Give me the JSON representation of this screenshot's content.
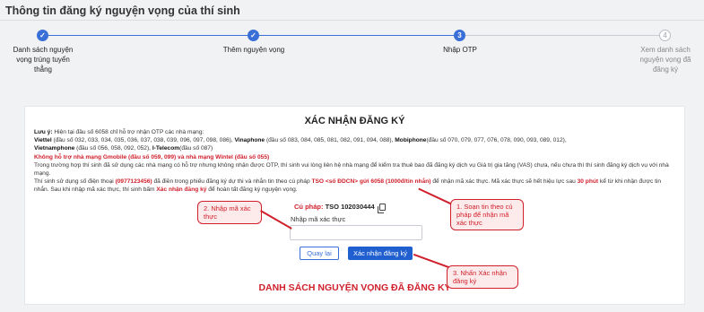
{
  "page": {
    "title": "Thông tin đăng ký nguyện vọng của thí sinh"
  },
  "steps": [
    {
      "icon": "check-icon",
      "label": "Danh sách nguyện vọng trúng tuyển thẳng",
      "state": "done",
      "mark": "✓"
    },
    {
      "icon": "check-icon",
      "label": "Thêm nguyện vọng",
      "state": "done",
      "mark": "✓"
    },
    {
      "icon": "step-3",
      "label": "Nhập OTP",
      "state": "active",
      "mark": "3"
    },
    {
      "icon": "step-4",
      "label": "Xem danh sách nguyện vọng đã đăng ký",
      "state": "pending",
      "mark": "4"
    }
  ],
  "card": {
    "title": "XÁC NHẬN ĐĂNG KÝ",
    "note_lead": "Lưu ý:",
    "note_intro": " Hiện tại đầu số 6058 chỉ hỗ trợ nhận OTP các nhà mạng:",
    "carriers_1": {
      "viettel": "Viettel",
      "viettel_nums": " (đầu số 032, 033, 034, 035, 036, 037, 038, 039, 096, 097, 098, 086), ",
      "vinaphone": "Vinaphone",
      "vinaphone_nums": " (đầu số 083, 084, 085, 081, 082, 091, 094, 088), ",
      "mobiphone": "Mobiphone",
      "mobiphone_nums": "(đầu số 070, 079, 077, 076, 078, 090, 093, 089, 012),"
    },
    "carriers_2": {
      "vietnamphone": "Vietnamphone",
      "vietnamphone_nums": " (đầu số 056, 058, 092, 052), ",
      "itelecom": "I-Telecom",
      "itelecom_nums": "(đầu số 087)"
    },
    "unsupported": "Không hỗ trợ nhà mạng Gmobile (đầu số 059, 099) và nhà mạng Wintel (đầu số 055)",
    "vas_note": "Trong trường hợp thí sinh đã sử dụng các nhà mạng có hỗ trợ nhưng không nhận được OTP, thí sinh vui lòng liên hệ nhà mạng để kiểm tra thuê bao đã đăng ký dịch vụ Giá trị gia tăng (VAS) chưa, nếu chưa thì thí sinh đăng ký dịch vụ với nhà mạng.",
    "sms": {
      "p1": "Thí sinh sử dụng số điện thoại ",
      "phone": "(0977123456)",
      "p2": " đã điền trong phiếu đăng ký dự thi và nhắn tin theo cú pháp ",
      "syntax": "TSO <số ĐDCN> gửi 6058 (1000đ/tin nhắn)",
      "p3": " để nhận mã xác thực. Mã xác thực sẽ hết hiệu lực sau ",
      "minutes": "30 phút",
      "p4": " kể từ khi nhận được tin nhắn. Sau khi nhập mã xác thực, thí sinh bấm ",
      "confirm_word": "Xác nhận đăng ký",
      "p5": " để hoàn tất đăng ký nguyện vọng."
    },
    "syntax_label": "Cú pháp:",
    "syntax_value": "TSO 102030444",
    "otp_label": "Nhập mã xác thực",
    "otp_placeholder": "",
    "back_label": "Quay lại",
    "confirm_label": "Xác nhận đăng ký",
    "list_title": "DANH SÁCH NGUYỆN VỌNG ĐÃ ĐĂNG KÝ"
  },
  "callouts": {
    "c1": "1. Soạn tin theo cú pháp để nhận mã xác thực",
    "c2": "2. Nhập mã xác thực",
    "c3": "3. Nhấn Xác nhận đăng ký"
  },
  "colors": {
    "accent": "#1f5fd0",
    "alert": "#d0202c"
  }
}
